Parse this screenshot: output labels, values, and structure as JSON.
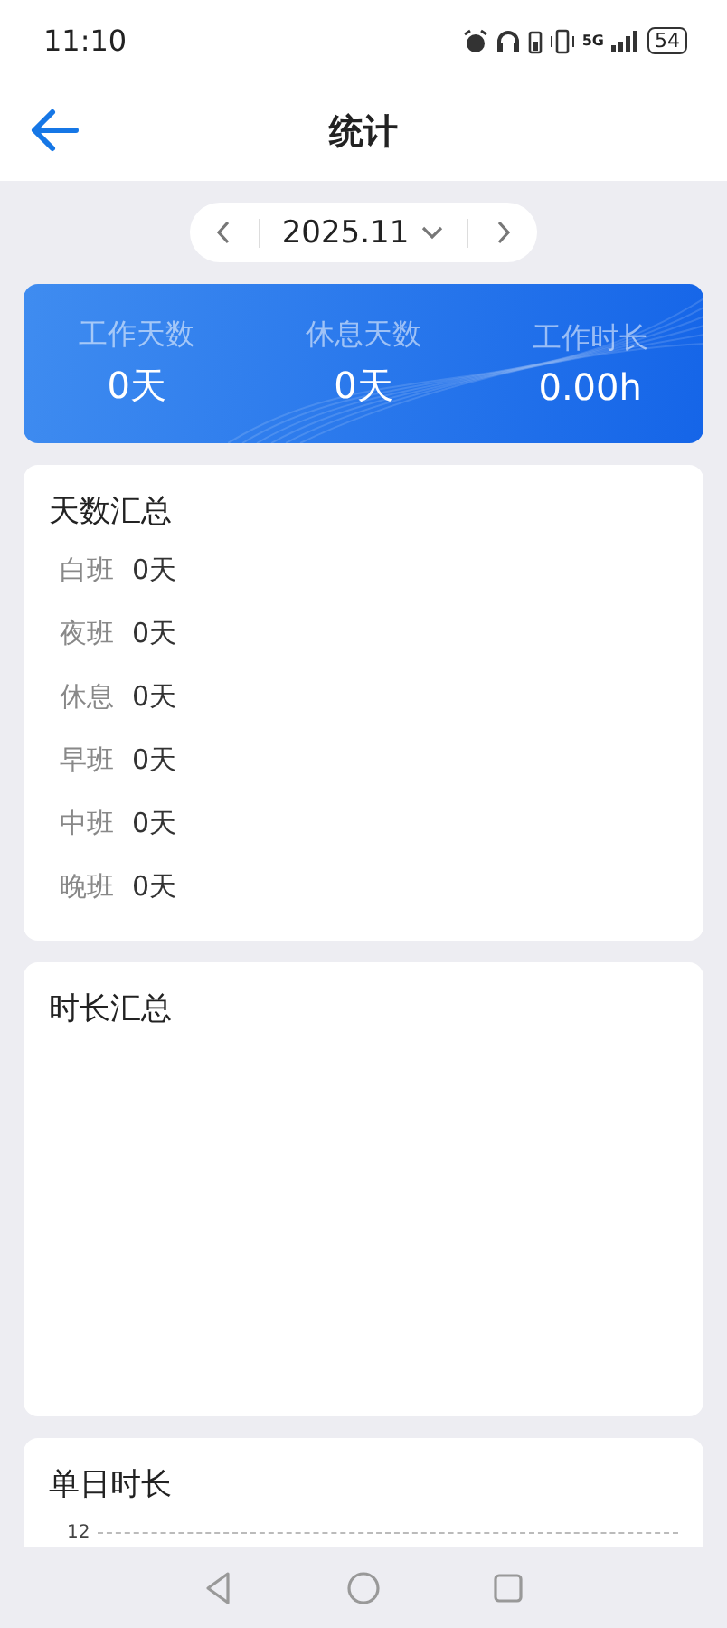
{
  "status_bar": {
    "time": "11:10",
    "battery": "54",
    "network": "5G"
  },
  "header": {
    "title": "统计"
  },
  "month_picker": {
    "value": "2025.11"
  },
  "summary": [
    {
      "label": "工作天数",
      "value": "0天"
    },
    {
      "label": "休息天数",
      "value": "0天"
    },
    {
      "label": "工作时长",
      "value": "0.00h"
    }
  ],
  "days_summary": {
    "title": "天数汇总",
    "rows": [
      {
        "label": "白班",
        "value": "0天"
      },
      {
        "label": "夜班",
        "value": "0天"
      },
      {
        "label": "休息",
        "value": "0天"
      },
      {
        "label": "早班",
        "value": "0天"
      },
      {
        "label": "中班",
        "value": "0天"
      },
      {
        "label": "晚班",
        "value": "0天"
      }
    ]
  },
  "hours_summary": {
    "title": "时长汇总"
  },
  "daily_hours": {
    "title": "单日时长",
    "axis_label": "12"
  }
}
